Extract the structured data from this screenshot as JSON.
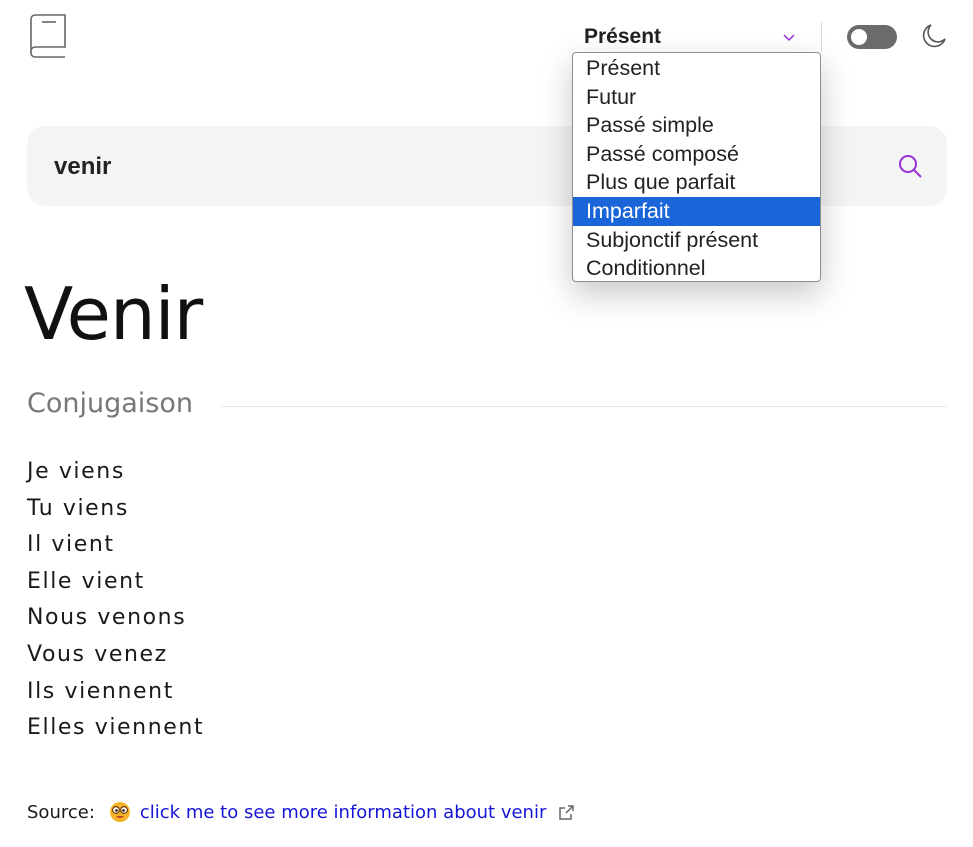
{
  "header": {
    "logo_icon": "book-icon",
    "tense_select": {
      "value": "Présent",
      "icon": "chevron-down-icon"
    },
    "theme_toggle": {
      "state": "off",
      "icon": "moon-icon"
    }
  },
  "dropdown": {
    "options": [
      "Présent",
      "Futur",
      "Passé simple",
      "Passé composé",
      "Plus que parfait",
      "Imparfait",
      "Subjonctif présent",
      "Conditionnel"
    ],
    "highlighted": "Imparfait"
  },
  "search": {
    "value": "venir",
    "icon": "search-icon"
  },
  "main": {
    "word": "Venir",
    "section_title": "Conjugaison",
    "conjugations": [
      "Je viens",
      "Tu viens",
      "Il vient",
      "Elle vient",
      "Nous venons",
      "Vous venez",
      "Ils viennent",
      "Elles viennent"
    ]
  },
  "source": {
    "label": "Source:",
    "emoji_icon": "face-with-glasses-emoji-icon",
    "link_text": "click me to see more information about venir",
    "external_icon": "external-link-icon"
  },
  "colors": {
    "accent": "#9b30d9",
    "highlight": "#1a66d9",
    "link": "#1515d8",
    "toggle_track": "#6b6b6b",
    "search_bg": "#f4f4f4"
  }
}
